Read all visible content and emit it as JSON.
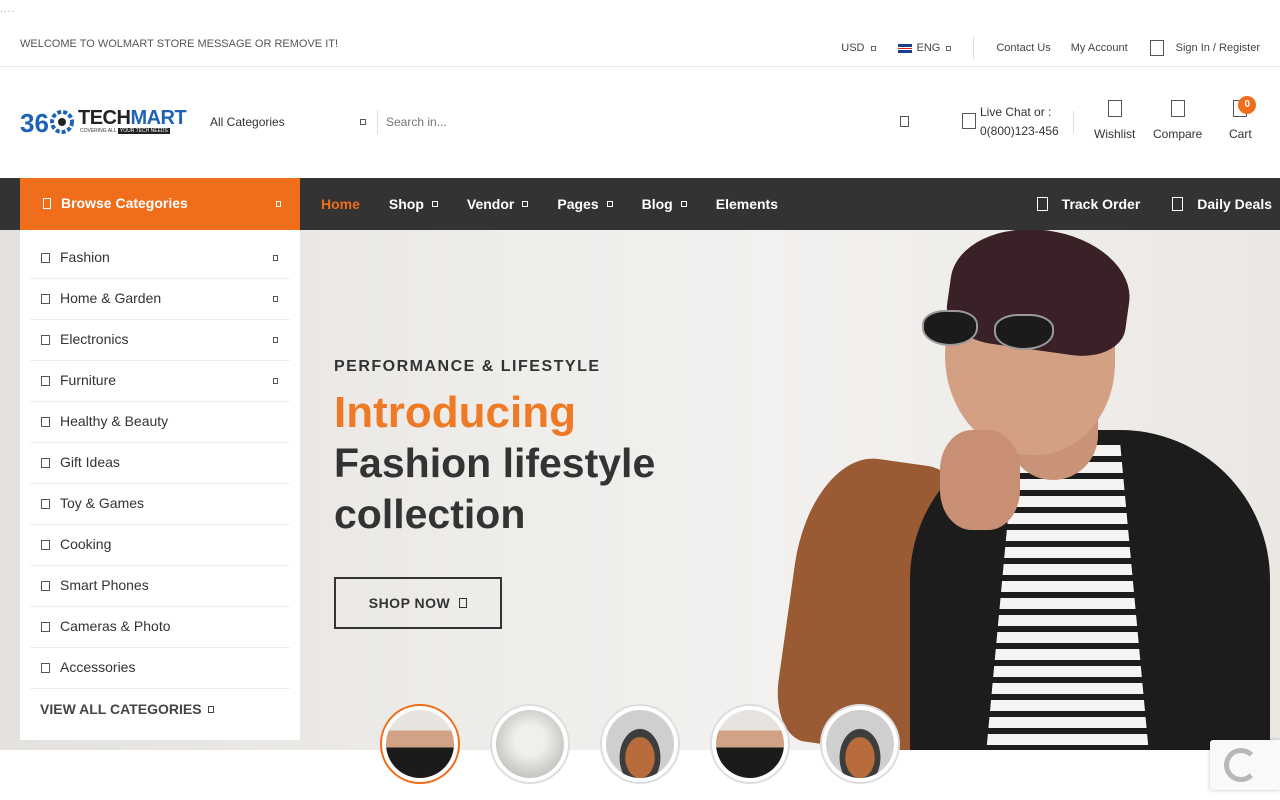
{
  "loader": "....",
  "topbar": {
    "welcome": "WELCOME TO WOLMART STORE MESSAGE OR REMOVE IT!",
    "currency": "USD",
    "language": "ENG",
    "contact": "Contact Us",
    "account": "My Account",
    "sign_in": "Sign In / Register"
  },
  "header": {
    "logo_text_a": "36",
    "logo_text_b": "TECH",
    "logo_text_c": "MART",
    "logo_tag_a": "COVERING ALL",
    "logo_tag_b": "YOUR TECH NEEDS",
    "category_select": "All Categories",
    "search_placeholder": "Search in...",
    "live_chat_label": "Live Chat or :",
    "live_chat_phone": "0(800)123-456",
    "wishlist": "Wishlist",
    "compare": "Compare",
    "cart": "Cart",
    "cart_count": "0"
  },
  "nav": {
    "browse": "Browse Categories",
    "items": [
      {
        "label": "Home"
      },
      {
        "label": "Shop"
      },
      {
        "label": "Vendor"
      },
      {
        "label": "Pages"
      },
      {
        "label": "Blog"
      },
      {
        "label": "Elements"
      }
    ],
    "track_order": "Track Order",
    "daily_deals": "Daily Deals"
  },
  "categories": {
    "items": [
      {
        "label": "Fashion"
      },
      {
        "label": "Home & Garden"
      },
      {
        "label": "Electronics"
      },
      {
        "label": "Furniture"
      },
      {
        "label": "Healthy & Beauty"
      },
      {
        "label": "Gift Ideas"
      },
      {
        "label": "Toy & Games"
      },
      {
        "label": "Cooking"
      },
      {
        "label": "Smart Phones"
      },
      {
        "label": "Cameras & Photo"
      },
      {
        "label": "Accessories"
      }
    ],
    "view_all": "VIEW ALL CATEGORIES"
  },
  "hero": {
    "subtitle": "PERFORMANCE & LIFESTYLE",
    "title_highlight": "Introducing",
    "title_main": "Fashion lifestyle collection",
    "button": "SHOP NOW"
  },
  "colors": {
    "accent": "#ef6d1b",
    "nav_bg": "#333333"
  }
}
